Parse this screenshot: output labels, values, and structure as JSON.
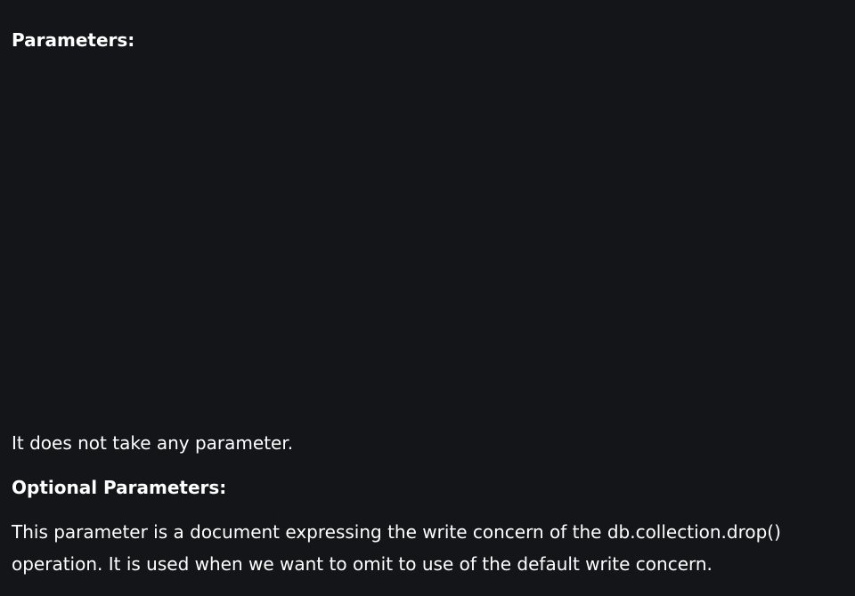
{
  "section": {
    "parameters_heading": "Parameters:",
    "no_parameter_text": "It does not take any parameter.",
    "optional_heading": "Optional Parameters:",
    "write_concern_text": "This parameter is a document expressing the write concern of the db.collection.drop() operation. It is used when we want to omit to use of the default write concern."
  },
  "colors": {
    "background": "#141519",
    "text": "#ffffff"
  }
}
